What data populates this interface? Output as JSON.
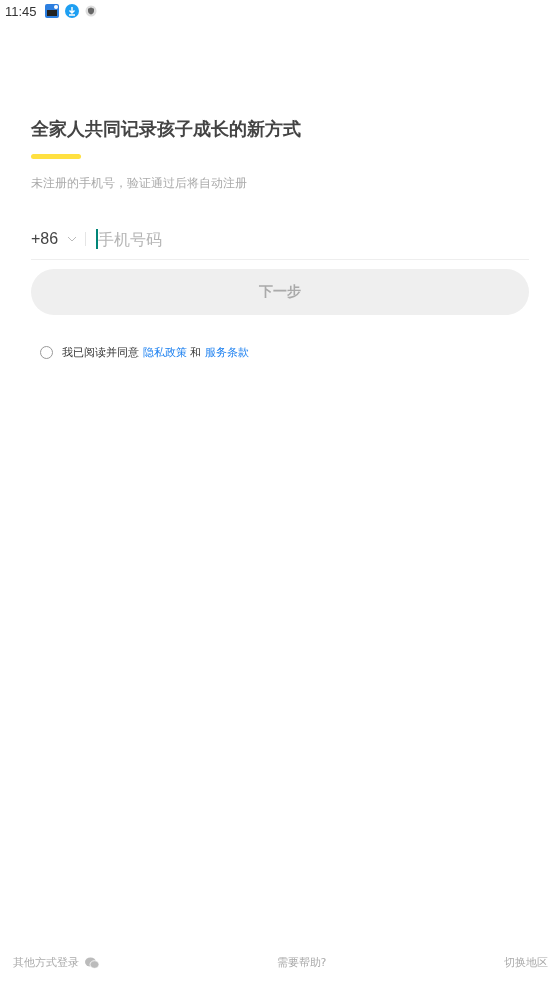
{
  "status_bar": {
    "time": "11:45"
  },
  "title": "全家人共同记录孩子成长的新方式",
  "subtitle": "未注册的手机号，验证通过后将自动注册",
  "phone": {
    "country_code": "+86",
    "placeholder": "手机号码"
  },
  "next_button": {
    "label": "下一步",
    "disabled": true
  },
  "agreement": {
    "checked": false,
    "text_before": "我已阅读并同意",
    "privacy_link": "隐私政策",
    "conjunction": "和",
    "terms_link": "服务条款"
  },
  "footer": {
    "other_login": "其他方式登录",
    "help": "需要帮助?",
    "switch_region": "切换地区"
  }
}
